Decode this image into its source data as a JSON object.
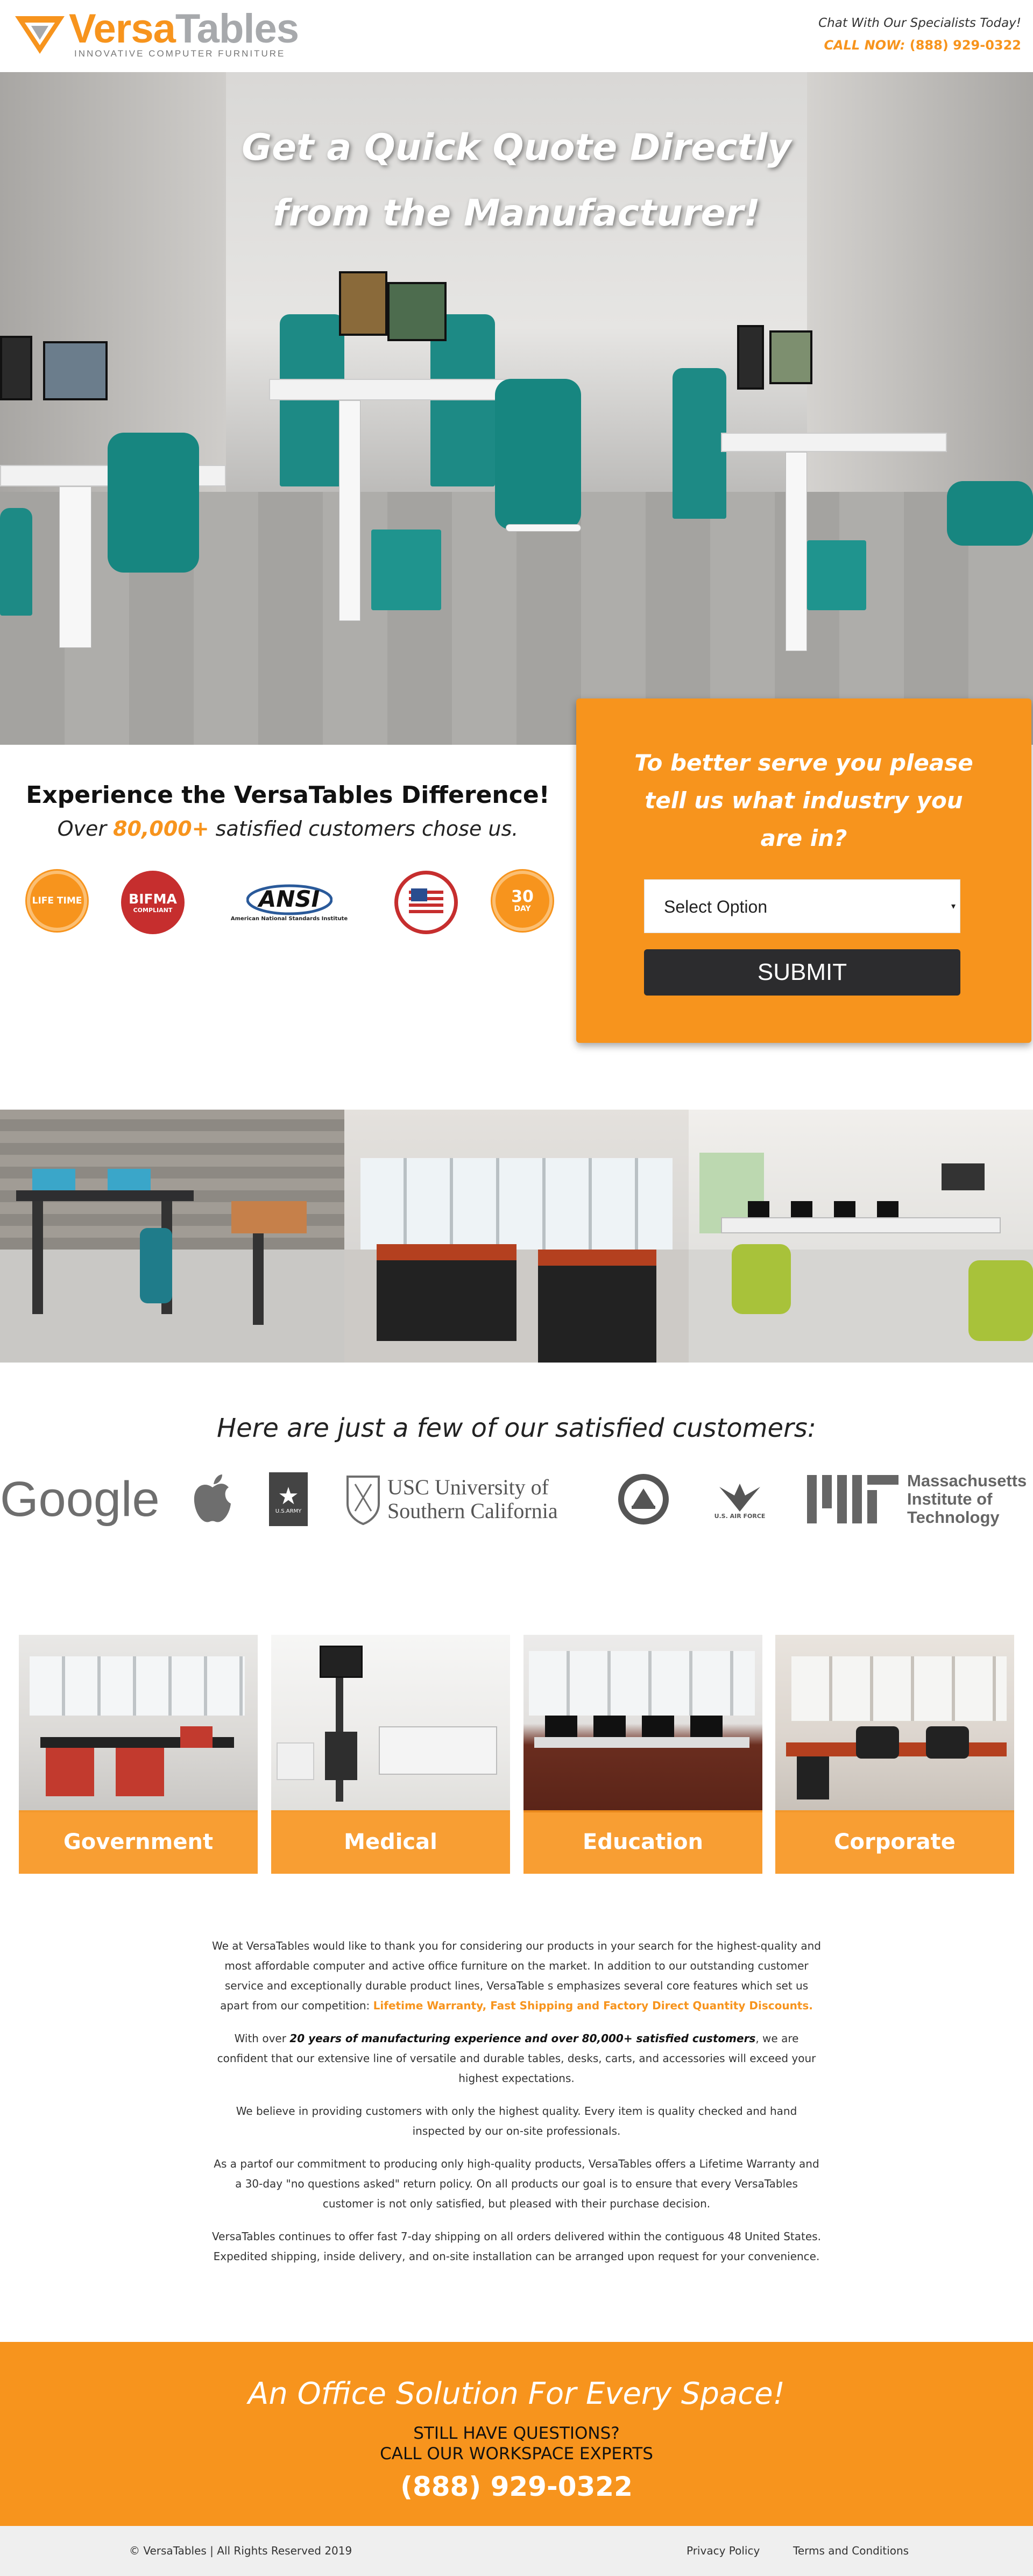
{
  "header": {
    "logo_primary": "Versa",
    "logo_secondary": "Tables",
    "logo_tagline": "INNOVATIVE COMPUTER FURNITURE",
    "chat_text": "Chat With Our Specialists Today!",
    "call_label": "CALL NOW:",
    "call_number": "(888) 929-0322"
  },
  "hero": {
    "headline_line1": "Get a Quick Quote Directly",
    "headline_line2": "from the Manufacturer!"
  },
  "difference": {
    "title": "Experience the VersaTables Difference!",
    "subtitle_prefix": "Over ",
    "subtitle_highlight": "80,000+",
    "subtitle_suffix": " satisfied customers chose us.",
    "badges": [
      {
        "name": "lifetime-badge",
        "text": "LIFE TIME"
      },
      {
        "name": "bifma-badge",
        "text": "BIFMA",
        "sub": "COMPLIANT"
      },
      {
        "name": "ansi-badge",
        "text": "ANSI",
        "sub": "American National Standards Institute"
      },
      {
        "name": "usa-badge",
        "text": ""
      },
      {
        "name": "30-day-badge",
        "text": "30",
        "sub": "DAY"
      }
    ]
  },
  "form": {
    "heading_line1": "To better serve you please",
    "heading_line2": "tell us what industry you",
    "heading_line3": "are in?",
    "select_value": "Select Option",
    "submit_label": "SUBMIT"
  },
  "customers": {
    "title": "Here are just a few of our satisfied customers:",
    "logos": {
      "google": "Google",
      "army": "U.S.ARMY",
      "usc_line1": "USC University of",
      "usc_line2": "Southern California",
      "airforce": "U.S. AIR FORCE",
      "mit_line1": "Massachusetts",
      "mit_line2": "Institute of",
      "mit_line3": "Technology"
    }
  },
  "industries": [
    {
      "label": "Government"
    },
    {
      "label": "Medical"
    },
    {
      "label": "Education"
    },
    {
      "label": "Corporate"
    }
  ],
  "about": {
    "p1_text": "We at VersaTables would like to thank you for considering our products in your search for the highest-quality and most affordable computer and active office furniture on the market. In addition to our outstanding customer service and exceptionally durable product lines, VersaTable s emphasizes several core features which set us apart from our competition: ",
    "p1_highlight": "Lifetime Warranty, Fast Shipping and Factory Direct Quantity Discounts.",
    "p2_prefix": "With over ",
    "p2_bold": "20 years of manufacturing experience and over 80,000+ satisfied customers",
    "p2_suffix": ", we are confident that our extensive line of versatile and durable tables, desks, carts, and accessories will exceed your highest expectations.",
    "p3": "We believe in providing customers with only the highest quality. Every item is quality checked and hand inspected by our on-site professionals.",
    "p4": "As a partof our commitment to producing only high-quality products, VersaTables offers a Lifetime Warranty and a 30-day \"no questions asked\" return policy. On all products our goal is to ensure that every VersaTables customer is not only satisfied, but pleased with their purchase decision.",
    "p5": "VersaTables continues to offer fast 7-day shipping on all orders delivered within the contiguous 48 United States. Expedited shipping, inside delivery, and on-site installation can be arranged upon request for your convenience."
  },
  "banner": {
    "headline": "An Office Solution For Every Space!",
    "question_line1": "STILL HAVE QUESTIONS?",
    "question_line2": "CALL OUR WORKSPACE EXPERTS",
    "phone": "(888) 929-0322"
  },
  "footer": {
    "copyright": "© VersaTables | All Rights Reserved 2019",
    "privacy": "Privacy Policy",
    "terms": "Terms and Conditions"
  },
  "colors": {
    "accent": "#f7941d",
    "dark_button": "#2c2c2e",
    "teal_furniture": "#1d8a85"
  }
}
